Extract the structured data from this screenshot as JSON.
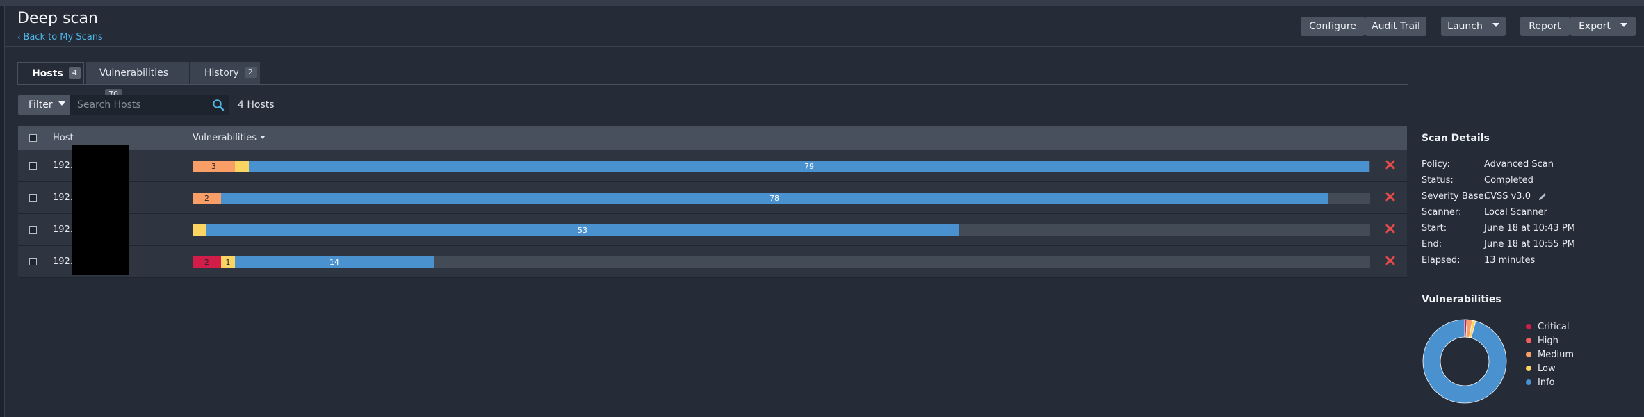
{
  "page": {
    "title": "Deep scan",
    "back_link": "Back to My Scans"
  },
  "toolbar": {
    "configure": "Configure",
    "audit_trail": "Audit Trail",
    "launch": "Launch",
    "report": "Report",
    "export": "Export"
  },
  "tabs": [
    {
      "label": "Hosts",
      "count": "4",
      "active": true
    },
    {
      "label": "Vulnerabilities",
      "count": "70",
      "active": false
    },
    {
      "label": "History",
      "count": "2",
      "active": false
    }
  ],
  "filter": {
    "label": "Filter",
    "search_placeholder": "Search Hosts",
    "count_label": "4 Hosts"
  },
  "table": {
    "col_host": "Host",
    "col_vulns": "Vulnerabilities",
    "rows": [
      {
        "host": "192.",
        "critical": 0,
        "high": 0,
        "medium": 3,
        "low": 1,
        "info": 79,
        "labels": {
          "critical": "",
          "medium": "3",
          "low": "",
          "info": "79"
        }
      },
      {
        "host": "192.",
        "critical": 0,
        "high": 0,
        "medium": 2,
        "low": 0,
        "info": 78,
        "labels": {
          "critical": "",
          "medium": "2",
          "low": "",
          "info": "78"
        }
      },
      {
        "host": "192.",
        "critical": 0,
        "high": 0,
        "medium": 0,
        "low": 1,
        "info": 53,
        "labels": {
          "critical": "",
          "medium": "",
          "low": "",
          "info": "53"
        }
      },
      {
        "host": "192.",
        "critical": 2,
        "high": 0,
        "medium": 0,
        "low": 1,
        "info": 14,
        "labels": {
          "critical": "2",
          "medium": "",
          "low": "1",
          "info": "14"
        }
      }
    ]
  },
  "scan_details": {
    "heading": "Scan Details",
    "items": [
      {
        "label": "Policy:",
        "value": "Advanced Scan"
      },
      {
        "label": "Status:",
        "value": "Completed"
      },
      {
        "label": "Severity Base:",
        "value": "CVSS v3.0"
      },
      {
        "label": "Scanner:",
        "value": "Local Scanner"
      },
      {
        "label": "Start:",
        "value": "June 18 at 10:43 PM"
      },
      {
        "label": "End:",
        "value": "June 18 at 10:55 PM"
      },
      {
        "label": "Elapsed:",
        "value": "13 minutes"
      }
    ]
  },
  "vuln_summary": {
    "heading": "Vulnerabilities",
    "legend": [
      "Critical",
      "High",
      "Medium",
      "Low",
      "Info"
    ]
  },
  "colors": {
    "critical": "#d11d48",
    "high": "#f25e5c",
    "medium": "#f99e67",
    "low": "#fbd461",
    "info": "#4a91cf",
    "bar_track": "#434b57",
    "link": "#4fb6e8",
    "remove": "#e64b4b"
  },
  "chart_data": {
    "type": "pie",
    "title": "Vulnerabilities",
    "categories": [
      "Critical",
      "High",
      "Medium",
      "Low",
      "Info"
    ],
    "values": [
      2,
      0,
      5,
      3,
      224
    ]
  }
}
